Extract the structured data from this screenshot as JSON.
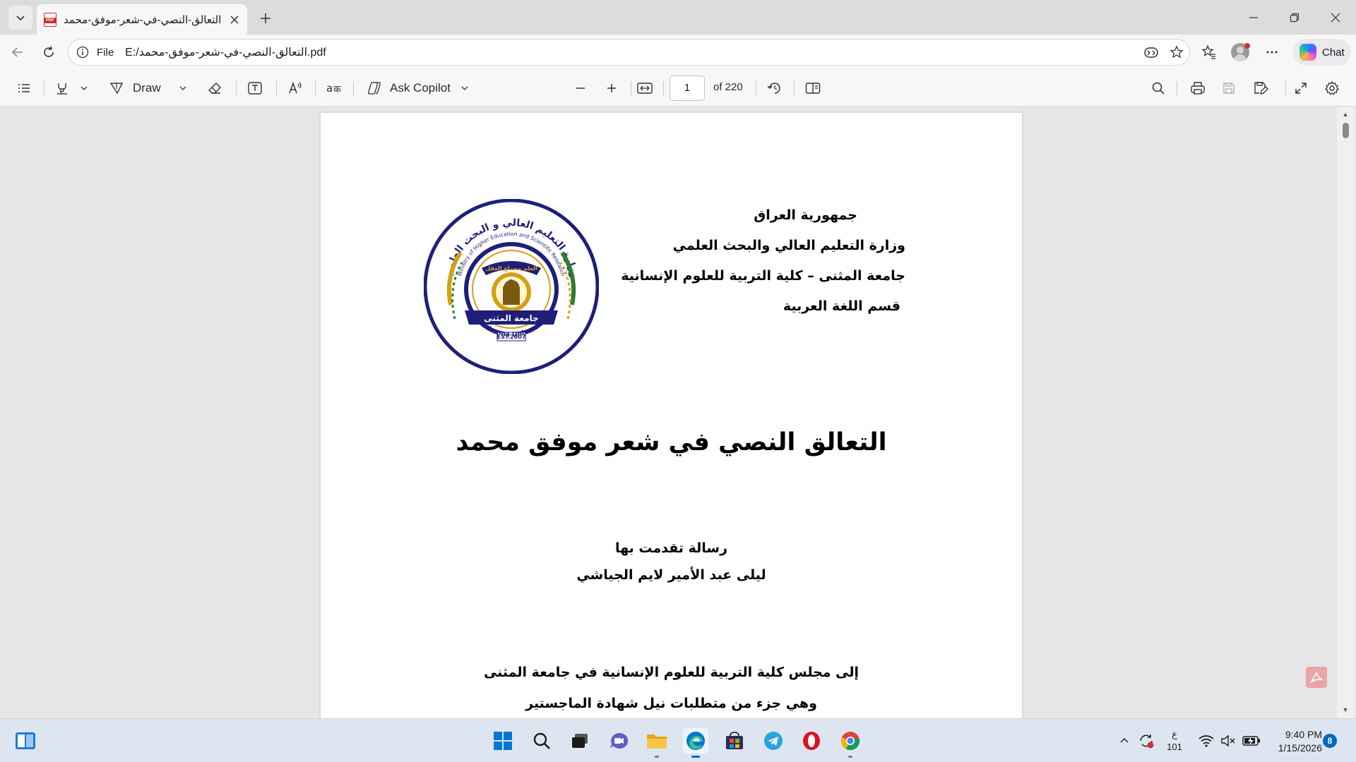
{
  "browser": {
    "tab": {
      "title": "التعالق-النصي-في-شعر-موفق-محمد",
      "favicon_text": "PDF"
    },
    "address": {
      "scheme_label": "File",
      "url": "E:/التعالق-النصي-في-شعر-موفق-محمد.pdf"
    },
    "chat_label": "Chat"
  },
  "pdf_toolbar": {
    "draw_label": "Draw",
    "copilot_label": "Ask Copilot",
    "page_current": "1",
    "page_total": "of 220"
  },
  "document": {
    "header_lines": [
      "جمهورية العراق",
      "وزارة التعليم العالي والبحث العلمي",
      "جامعة المثنى – كلية التربية للعلوم الإنسانية",
      "قسم اللغة العربية"
    ],
    "logo": {
      "arc_text_ar": "وزارة التعليم العالي و البحث العلمي",
      "arc_text_en": "Ministry of Higher Education and Scientific Research",
      "motto": "العلم مصباح العقل",
      "name_ar": "جامعة المثنى",
      "established": "EST.2007",
      "name_en": "Muthanna University"
    },
    "title": "التعالق النصي في شعر موفق محمد",
    "submitted_by_label": "رسالة تقدمت بها",
    "author": "ليلى عبد الأمير لايم الجياشي",
    "submitted_to": "إلى مجلس كلية التربية للعلوم الإنسانية في جامعة المثنى",
    "degree_line": "وهي جزء من متطلبات نيل شهادة الماجستير"
  },
  "taskbar": {
    "keyboard_lang": "ع",
    "keyboard_code": "101",
    "time": "9:40 PM",
    "date": "1/15/2026",
    "notification_count": "8"
  },
  "colors": {
    "pdf_red": "#cc2b2b",
    "edge_blue": "#0078d4",
    "logo_navy": "#1f1f7a",
    "logo_gold": "#d4a017",
    "logo_green": "#2e7d32"
  }
}
